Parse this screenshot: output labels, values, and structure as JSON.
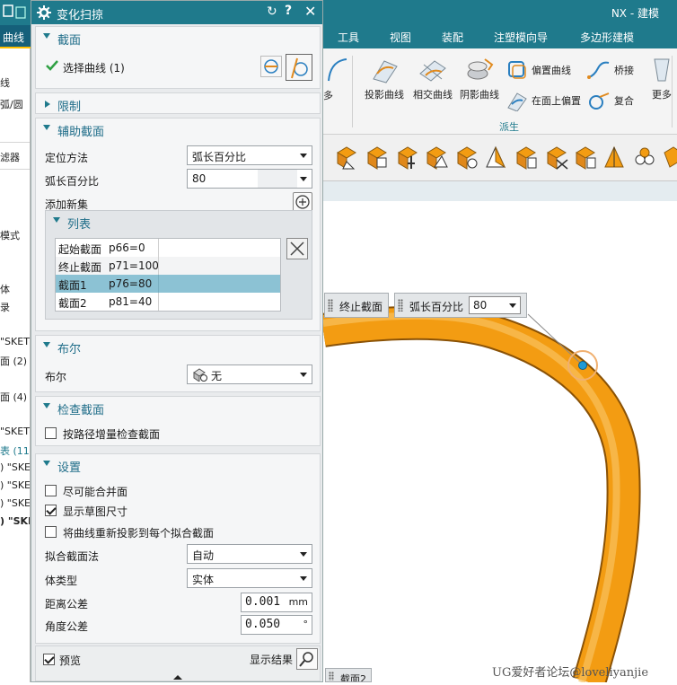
{
  "app": {
    "title": "NX - 建模"
  },
  "menubar": {
    "curve_tab": "曲线",
    "items": [
      "工具",
      "视图",
      "装配",
      "注塑模向导",
      "多边形建模"
    ]
  },
  "ribbon": {
    "more_left": "多",
    "buttons": [
      "投影曲线",
      "相交曲线",
      "阴影曲线"
    ],
    "small_buttons": [
      "偏置曲线",
      "在面上偏置",
      "桥接",
      "复合"
    ],
    "more": "更多",
    "group_label": "派生"
  },
  "leftnav": {
    "items": [
      "线",
      "弧/圆",
      "滤器",
      "模式",
      "体",
      "录",
      "\"SKET",
      "面 (2)",
      "面 (4)",
      "\"SKET",
      "表 (11)",
      ") \"SKE",
      ") \"SKE",
      ") \"SKE",
      ") \"SKI"
    ]
  },
  "dialog": {
    "title": "变化扫掠",
    "section_section": {
      "title": "截面",
      "select_curve": "选择曲线 (1)"
    },
    "section_limit": {
      "title": "限制"
    },
    "section_aux": {
      "title": "辅助截面",
      "locate_method_label": "定位方法",
      "locate_method_value": "弧长百分比",
      "arc_pct_label": "弧长百分比",
      "arc_pct_value": "80",
      "add_new_label": "添加新集",
      "list": {
        "title": "列表",
        "rows": [
          {
            "name": "起始截面",
            "value": "p66=0"
          },
          {
            "name": "终止截面",
            "value": "p71=100"
          },
          {
            "name": "截面1",
            "value": "p76=80"
          },
          {
            "name": "截面2",
            "value": "p81=40"
          }
        ]
      }
    },
    "section_bool": {
      "title": "布尔",
      "label": "布尔",
      "value": "无"
    },
    "section_check": {
      "title": "检查截面",
      "checkbox_label": "按路径增量检查截面"
    },
    "section_settings": {
      "title": "设置",
      "cb1": "尽可能合并面",
      "cb2": "显示草图尺寸",
      "cb3": "将曲线重新投影到每个拟合截面",
      "fit_label": "拟合截面法",
      "fit_value": "自动",
      "body_label": "体类型",
      "body_value": "实体",
      "dist_tol_label": "距离公差",
      "dist_tol_value": "0.001",
      "dist_tol_unit": "mm",
      "angle_tol_label": "角度公差",
      "angle_tol_value": "0.050",
      "angle_tol_unit": "°"
    },
    "footer": {
      "preview_label": "预览",
      "show_result_label": "显示结果"
    }
  },
  "graphics": {
    "end_section_label": "终止截面",
    "arc_pct_label": "弧长百分比",
    "arc_pct_value": "80",
    "bottom_label": "截面2",
    "watermark": "UG爱好者论坛@loveliyanjie"
  },
  "colors": {
    "accent": "#1f7a8c",
    "tube": "#f39c12",
    "selection": "#8cc2d4"
  }
}
